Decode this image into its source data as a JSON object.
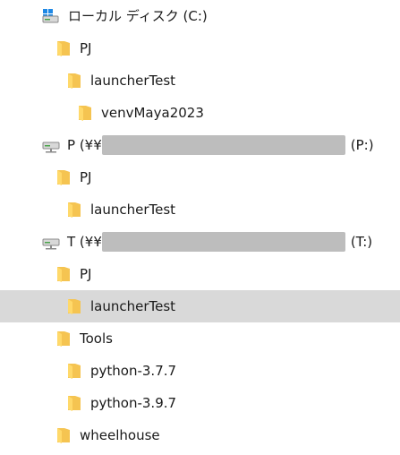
{
  "tree": {
    "local_drive": {
      "label": "ローカル ディスク (C:)",
      "icon": "local-disk-icon"
    },
    "c_pj": {
      "label": "PJ",
      "icon": "folder-icon"
    },
    "c_launcher": {
      "label": "launcherTest",
      "icon": "folder-icon"
    },
    "c_venv": {
      "label": "venvMaya2023",
      "icon": "folder-icon"
    },
    "p_drive": {
      "prefix": "P (¥¥",
      "suffix": "(P:)",
      "icon": "network-drive-icon"
    },
    "p_pj": {
      "label": "PJ",
      "icon": "folder-icon"
    },
    "p_launcher": {
      "label": "launcherTest",
      "icon": "folder-icon"
    },
    "t_drive": {
      "prefix": "T (¥¥",
      "suffix": "(T:)",
      "icon": "network-drive-icon"
    },
    "t_pj": {
      "label": "PJ",
      "icon": "folder-icon"
    },
    "t_launcher": {
      "label": "launcherTest",
      "icon": "folder-icon",
      "selected": true
    },
    "t_tools": {
      "label": "Tools",
      "icon": "folder-icon"
    },
    "t_py377": {
      "label": "python-3.7.7",
      "icon": "folder-icon"
    },
    "t_py397": {
      "label": "python-3.9.7",
      "icon": "folder-icon"
    },
    "t_wheelhouse": {
      "label": "wheelhouse",
      "icon": "folder-icon"
    }
  },
  "colors": {
    "selection": "#d9d9d9",
    "folder_main": "#f5c451",
    "folder_front": "#ffd96a",
    "mask": "#bdbdbd"
  }
}
